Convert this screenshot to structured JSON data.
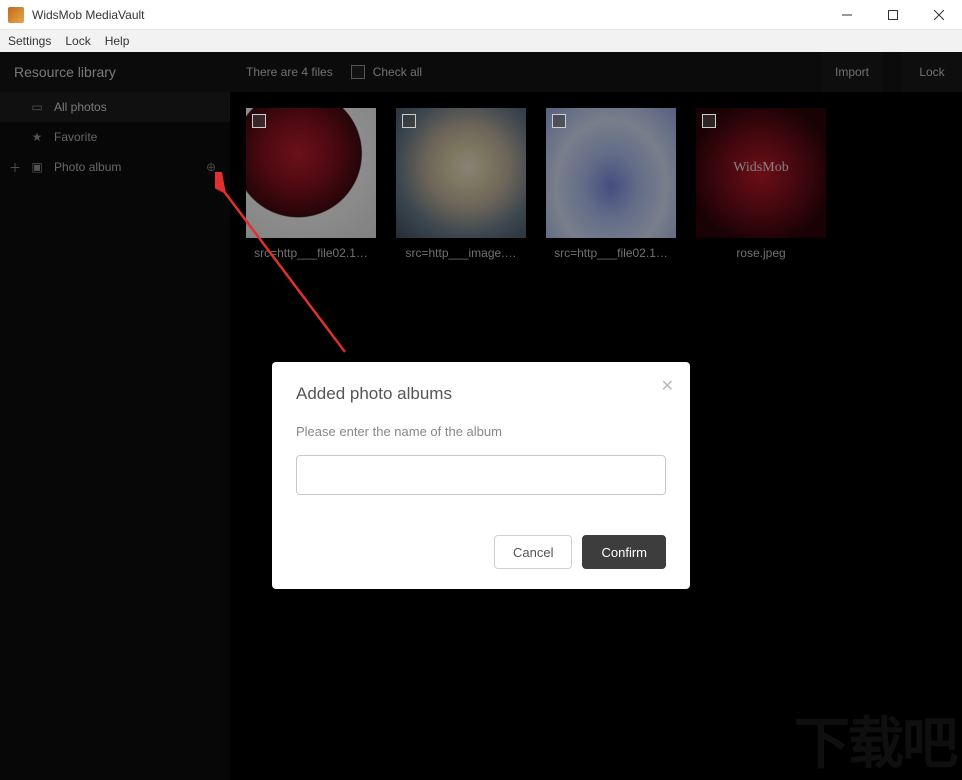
{
  "titlebar": {
    "title": "WidsMob MediaVault"
  },
  "menubar": {
    "items": [
      "Settings",
      "Lock",
      "Help"
    ]
  },
  "sidebar": {
    "header": "Resource library",
    "items": [
      {
        "icon": "photos-icon",
        "label": "All photos",
        "active": true
      },
      {
        "icon": "star-icon",
        "label": "Favorite"
      },
      {
        "icon": "album-icon",
        "label": "Photo album",
        "leading_plus": true,
        "trailing_add": true
      }
    ]
  },
  "content_header": {
    "count_text": "There are 4 files",
    "checkall_label": "Check all",
    "import_label": "Import",
    "lock_label": "Lock"
  },
  "thumbs": [
    {
      "label": "src=http___file02.1…"
    },
    {
      "label": "src=http___image.…"
    },
    {
      "label": "src=http___file02.1…"
    },
    {
      "label": "rose.jpeg"
    }
  ],
  "modal": {
    "title": "Added photo albums",
    "prompt": "Please enter the name of the album",
    "input_value": "",
    "cancel_label": "Cancel",
    "confirm_label": "Confirm"
  },
  "watermark": "下载吧"
}
